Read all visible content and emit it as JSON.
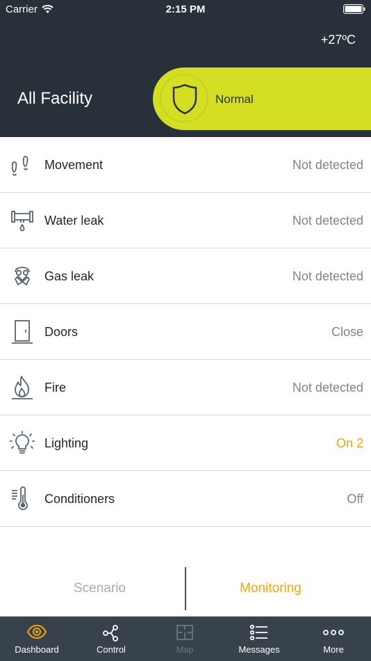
{
  "status_bar": {
    "carrier": "Carrier",
    "time": "2:15 PM"
  },
  "header": {
    "temperature": "+27ºC",
    "facility": "All Facility",
    "security_status": "Normal"
  },
  "sensors": [
    {
      "label": "Movement",
      "value": "Not detected",
      "icon": "footsteps-icon"
    },
    {
      "label": "Water leak",
      "value": "Not detected",
      "icon": "pipe-drop-icon"
    },
    {
      "label": "Gas leak",
      "value": "Not detected",
      "icon": "gas-mask-icon"
    },
    {
      "label": "Doors",
      "value": "Close",
      "icon": "door-icon"
    },
    {
      "label": "Fire",
      "value": "Not detected",
      "icon": "flame-icon"
    },
    {
      "label": "Lighting",
      "value": "On 2",
      "icon": "bulb-icon"
    },
    {
      "label": "Conditioners",
      "value": "Off",
      "icon": "thermometer-icon"
    }
  ],
  "segments": {
    "left": "Scenario",
    "right": "Monitoring"
  },
  "tabs": [
    {
      "label": "Dashboard",
      "icon": "eye-icon"
    },
    {
      "label": "Control",
      "icon": "share-nodes-icon"
    },
    {
      "label": "Map",
      "icon": "floor-plan-icon"
    },
    {
      "label": "Messages",
      "icon": "list-icon"
    },
    {
      "label": "More",
      "icon": "dots-icon"
    }
  ],
  "colors": {
    "header_bg": "#28313a",
    "accent_green": "#d4de22",
    "accent_orange": "#f2a30f",
    "tabbar_bg": "#38424c",
    "icon_gray": "#55636e"
  }
}
